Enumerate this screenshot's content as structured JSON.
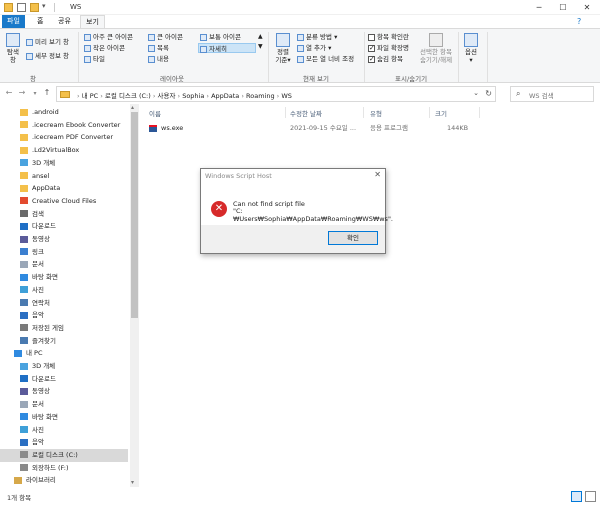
{
  "window": {
    "title": "WS",
    "controls": {
      "minimize": "─",
      "maximize": "☐",
      "close": "✕"
    }
  },
  "ribbon_tabs": [
    {
      "label": "파일"
    },
    {
      "label": "홈"
    },
    {
      "label": "공유"
    },
    {
      "label": "보기"
    }
  ],
  "ribbon": {
    "nav_pane": "탐색 창",
    "preview": "미리 보기 창",
    "details_pane": "세부 정보 창",
    "group_panes": "창",
    "layout": {
      "extra_large": "아주 큰 아이콘",
      "large": "큰 아이콘",
      "medium": "보통 아이콘",
      "small": "작은 아이콘",
      "list": "목록",
      "details": "자세히",
      "tiles": "타일",
      "content": "내용"
    },
    "group_layout": "레이아웃",
    "sort": "정렬",
    "sort_sub": "기준",
    "group_by": "분류 방법",
    "add_columns": "열 추가",
    "fit_columns": "모든 열 너비 조정",
    "group_current_view": "현재 보기",
    "item_checkboxes": "항목 확인란",
    "file_extensions": "파일 확장명",
    "hidden_items": "숨김 항목",
    "hide_selected_1": "선택한 항목",
    "hide_selected_2": "숨기기/해제",
    "group_showhide": "표시/숨기기",
    "options": "옵션"
  },
  "address": {
    "crumbs": [
      "내 PC",
      "로컬 디스크 (C:)",
      "사용자",
      "Sophia",
      "AppData",
      "Roaming",
      "WS"
    ],
    "separator": "›",
    "search_placeholder": "WS 검색"
  },
  "nav_items": [
    {
      "label": ".android",
      "icon": "folder-icon"
    },
    {
      "label": ".icecream Ebook Converter",
      "icon": "folder-icon"
    },
    {
      "label": ".icecream PDF Converter",
      "icon": "folder-icon"
    },
    {
      "label": ".Ld2VirtualBox",
      "icon": "folder-icon"
    },
    {
      "label": "3D 개체",
      "icon": "cube-icon"
    },
    {
      "label": "ansel",
      "icon": "folder-icon"
    },
    {
      "label": "AppData",
      "icon": "folder-icon"
    },
    {
      "label": "Creative Cloud Files",
      "icon": "cloud-folder-icon"
    },
    {
      "label": "검색",
      "icon": "search-icon"
    },
    {
      "label": "다운로드",
      "icon": "download-icon"
    },
    {
      "label": "동영상",
      "icon": "video-icon"
    },
    {
      "label": "링크",
      "icon": "link-icon"
    },
    {
      "label": "문서",
      "icon": "document-icon"
    },
    {
      "label": "바탕 화면",
      "icon": "desktop-icon"
    },
    {
      "label": "사진",
      "icon": "picture-icon"
    },
    {
      "label": "연락처",
      "icon": "contacts-icon"
    },
    {
      "label": "음악",
      "icon": "music-icon"
    },
    {
      "label": "저장된 게임",
      "icon": "game-icon"
    },
    {
      "label": "즐겨찾기",
      "icon": "star-icon"
    },
    {
      "label": "내 PC",
      "icon": "pc-icon"
    },
    {
      "label": "3D 개체",
      "icon": "cube-icon"
    },
    {
      "label": "다운로드",
      "icon": "download-icon"
    },
    {
      "label": "동영상",
      "icon": "video-icon"
    },
    {
      "label": "문서",
      "icon": "document-icon"
    },
    {
      "label": "바탕 화면",
      "icon": "desktop-icon"
    },
    {
      "label": "사진",
      "icon": "picture-icon"
    },
    {
      "label": "음악",
      "icon": "music-icon"
    },
    {
      "label": "로컬 디스크 (C:)",
      "icon": "drive-icon"
    },
    {
      "label": "외장하드 (F:)",
      "icon": "drive-icon"
    },
    {
      "label": "라이브러리",
      "icon": "library-icon"
    }
  ],
  "columns": {
    "name": "이름",
    "modified": "수정한 날짜",
    "type": "유형",
    "size": "크기"
  },
  "files": [
    {
      "name": "ws.exe",
      "modified": "2021-09-15 수요일 ...",
      "type": "응용 프로그램",
      "size": "144KB"
    }
  ],
  "dialog": {
    "title": "Windows Script Host",
    "close": "✕",
    "message_line1": "Can not find script file",
    "message_line2": "\"C:₩Users₩Sophia₩AppData₩Roaming₩WS₩ws\".",
    "ok_label": "확인"
  },
  "status": {
    "item_count": "1개 항목"
  },
  "colors": {
    "accent": "#1979ca",
    "error": "#d72a2a",
    "folder": "#f4c04a"
  }
}
